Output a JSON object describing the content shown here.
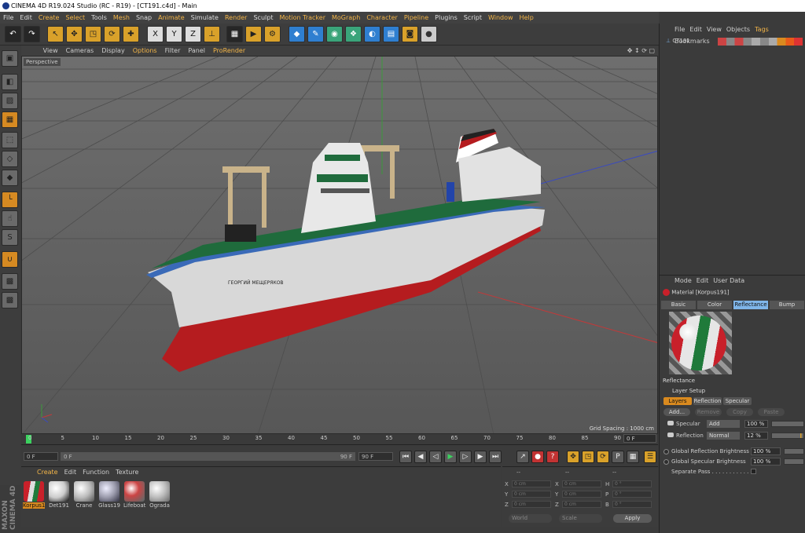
{
  "window": {
    "title": "CINEMA 4D R19.024 Studio (RC - R19) - [CT191.c4d] - Main"
  },
  "menubar": {
    "items": [
      "File",
      "Edit",
      "Create",
      "Select",
      "Tools",
      "Mesh",
      "Snap",
      "Animate",
      "Simulate",
      "Render",
      "Sculpt",
      "Motion Tracker",
      "MoGraph",
      "Character",
      "Pipeline",
      "Plugins",
      "Script",
      "Window",
      "Help"
    ],
    "highlight": [
      "Create",
      "Select",
      "Mesh",
      "Animate",
      "Render",
      "Motion Tracker",
      "MoGraph",
      "Character",
      "Pipeline",
      "Window",
      "Help"
    ]
  },
  "toolbar": {
    "undo_icon": "undo-icon",
    "redo_icon": "redo-icon",
    "tools": [
      "select-icon",
      "move-icon",
      "scale-icon",
      "rotate-icon",
      "live-icon",
      "x-axis-icon",
      "y-axis-icon",
      "z-axis-icon",
      "coord-system-icon",
      "render-view-icon",
      "render-picture-icon",
      "render-settings-icon",
      "cube-icon",
      "pen-icon",
      "subdivide-icon",
      "cloner-icon",
      "deformer-icon",
      "floor-icon",
      "camera-icon",
      "light-icon"
    ],
    "x_label": "X",
    "y_label": "Y",
    "z_label": "Z"
  },
  "viewport": {
    "menu": [
      "View",
      "Cameras",
      "Display",
      "Options",
      "Filter",
      "Panel",
      "ProRender"
    ],
    "menu_highlight": [
      "Options",
      "ProRender"
    ],
    "label": "Perspective",
    "grid_spacing": "Grid Spacing : 1000 cm",
    "ship_name": "ГЕОРГИЙ МЕЩЕРЯКОВ"
  },
  "timeline": {
    "ticks": [
      "0",
      "5",
      "10",
      "15",
      "20",
      "25",
      "30",
      "35",
      "40",
      "45",
      "50",
      "55",
      "60",
      "65",
      "70",
      "75",
      "80",
      "85",
      "90"
    ],
    "current": "0 F"
  },
  "transport": {
    "start": "0 F",
    "range_start": "0 F",
    "range_end": "90 F",
    "end": "90 F"
  },
  "material_manager": {
    "menu": [
      "Create",
      "Edit",
      "Function",
      "Texture"
    ],
    "materials": [
      {
        "name": "Korpus1",
        "selected": true
      },
      {
        "name": "Det191",
        "selected": false
      },
      {
        "name": "Crane",
        "selected": false
      },
      {
        "name": "Glass19",
        "selected": false
      },
      {
        "name": "Lifeboat",
        "selected": false
      },
      {
        "name": "Ograda",
        "selected": false
      }
    ]
  },
  "coordinates": {
    "header": [
      "--",
      "--",
      "--"
    ],
    "rows": [
      {
        "a": "X",
        "av": "0 cm",
        "b": "X",
        "bv": "0 cm",
        "c": "H",
        "cv": "0 °"
      },
      {
        "a": "Y",
        "av": "0 cm",
        "b": "Y",
        "bv": "0 cm",
        "c": "P",
        "cv": "0 °"
      },
      {
        "a": "Z",
        "av": "0 cm",
        "b": "Z",
        "bv": "0 cm",
        "c": "B",
        "cv": "0 °"
      }
    ],
    "world": "World",
    "scale": "Scale",
    "apply": "Apply"
  },
  "object_manager": {
    "menu": [
      "File",
      "Edit",
      "View",
      "Objects",
      "Tags",
      "Bookmarks"
    ],
    "menu_highlight": [
      "Tags"
    ],
    "object": "CT191"
  },
  "attribute_manager": {
    "menu": [
      "Mode",
      "Edit",
      "User Data"
    ],
    "title": "Material [Korpus191]",
    "tabs": [
      "Basic",
      "Color",
      "Reflectance",
      "Bump"
    ],
    "selected_tab": "Reflectance",
    "section": "Reflectance",
    "layer_setup": "Layer Setup",
    "layer_tabs": [
      "Layers",
      "Reflection",
      "Specular"
    ],
    "layer_buttons": [
      "Add...",
      "Remove",
      "Copy",
      "Paste"
    ],
    "specular": {
      "label": "Specular",
      "mode": "Add",
      "value": "100 %"
    },
    "reflection": {
      "label": "Reflection",
      "mode": "Normal",
      "value": "12 %"
    },
    "global_reflection": {
      "label": "Global Reflection Brightness",
      "value": "100 %"
    },
    "global_specular": {
      "label": "Global Specular Brightness",
      "value": "100 %"
    },
    "separate_pass": {
      "label": "Separate Pass . . . . . . . . . . . ."
    }
  },
  "branding": {
    "maxon": "MAXON CINEMA 4D"
  },
  "colors": {
    "accent": "#f3b548",
    "selection": "#d98a1f",
    "tab_selected": "#7fb5e8",
    "hull_red": "#b51c1f",
    "deck_green": "#1f6b3c"
  }
}
